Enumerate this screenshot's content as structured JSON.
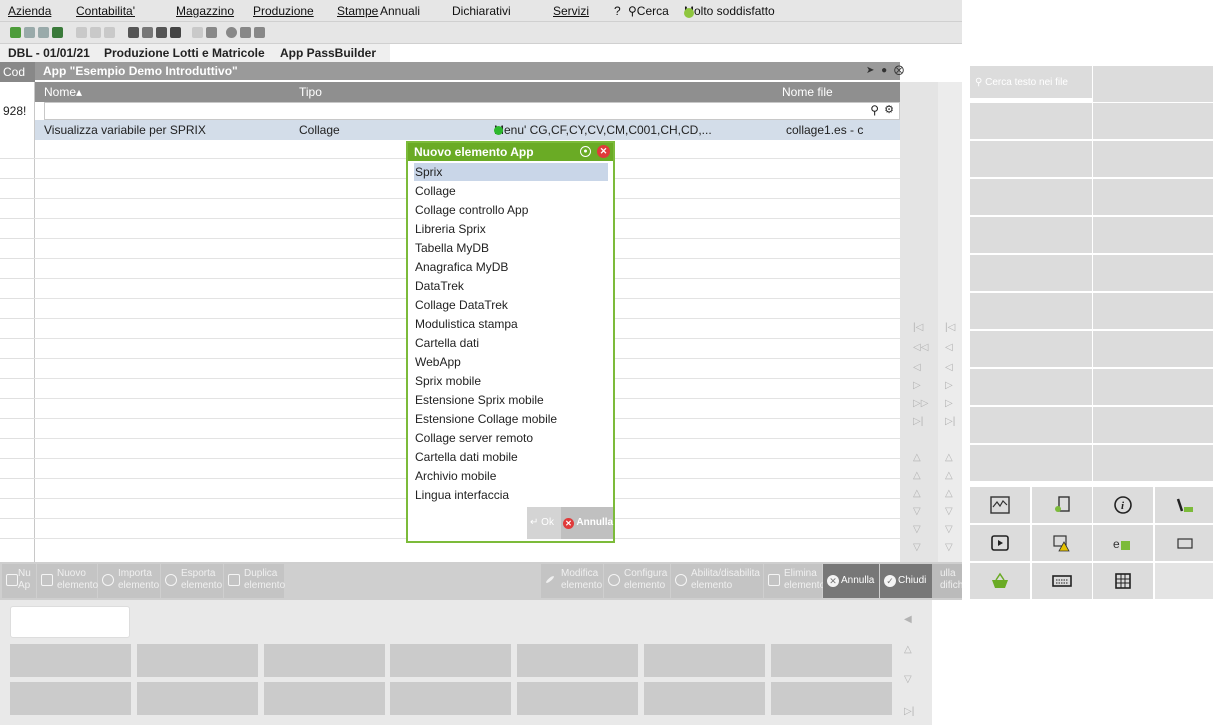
{
  "menu": {
    "items": [
      "Azienda",
      "Contabilita'",
      "Magazzino",
      "Produzione",
      "Stampe",
      "Annuali",
      "Dichiarativi",
      "Servizi"
    ],
    "help": "?",
    "search": "Cerca",
    "satisfaction": "Molto soddisfatto"
  },
  "tabs": [
    "DBL - 01/01/21",
    "Produzione Lotti e Matricole",
    "App PassBuilder"
  ],
  "left_column": {
    "header": "Cod",
    "value": "928!"
  },
  "window": {
    "title": "App \"Esempio Demo Introduttivo\"",
    "columns": {
      "name": "Nome▴",
      "type": "Tipo",
      "file": "Nome file"
    },
    "row": {
      "name": "Visualizza variabile per SPRIX",
      "type": "Collage",
      "menu": "Menu' CG,CF,CY,CV,CM,C001,CH,CD,...",
      "file": "collage1.es - c"
    }
  },
  "dialog": {
    "title": "Nuovo elemento App",
    "items": [
      "Sprix",
      "Collage",
      "Collage controllo App",
      "Libreria Sprix",
      "Tabella MyDB",
      "Anagrafica MyDB",
      "DataTrek",
      "Collage DataTrek",
      "Modulistica stampa",
      "Cartella dati",
      "WebApp",
      "Sprix mobile",
      "Estensione Sprix mobile",
      "Estensione Collage mobile",
      "Collage server remoto",
      "Cartella dati mobile",
      "Archivio mobile",
      "Lingua interfaccia"
    ],
    "selected": "Sprix",
    "ok": "Ok",
    "cancel": "Annulla"
  },
  "actions": {
    "nuova_app_l1": "Nu",
    "nuova_app_l2": "Ap",
    "nuovo_l1": "Nuovo",
    "nuovo_l2": "elemento",
    "importa_l1": "Importa",
    "importa_l2": "elemento",
    "esporta_l1": "Esporta",
    "esporta_l2": "elemento",
    "duplica_l1": "Duplica",
    "duplica_l2": "elemento",
    "modifica_l1": "Modifica",
    "modifica_l2": "elemento",
    "configura_l1": "Configura",
    "configura_l2": "elemento",
    "abilita_l1": "Abilita/disabilita",
    "abilita_l2": "elemento",
    "elimina_l1": "Elimina",
    "elimina_l2": "elemento",
    "annulla": "Annulla",
    "chiudi": "Chiudi",
    "annulla_modifiche_l1": "ulla",
    "annulla_modifiche_l2": "difiche"
  },
  "right_panel": {
    "search_placeholder": "Cerca testo nei file"
  },
  "colors": {
    "accent_green": "#6aab25",
    "selection": "#c9d6e8",
    "header_gray": "#8f8f8f"
  }
}
